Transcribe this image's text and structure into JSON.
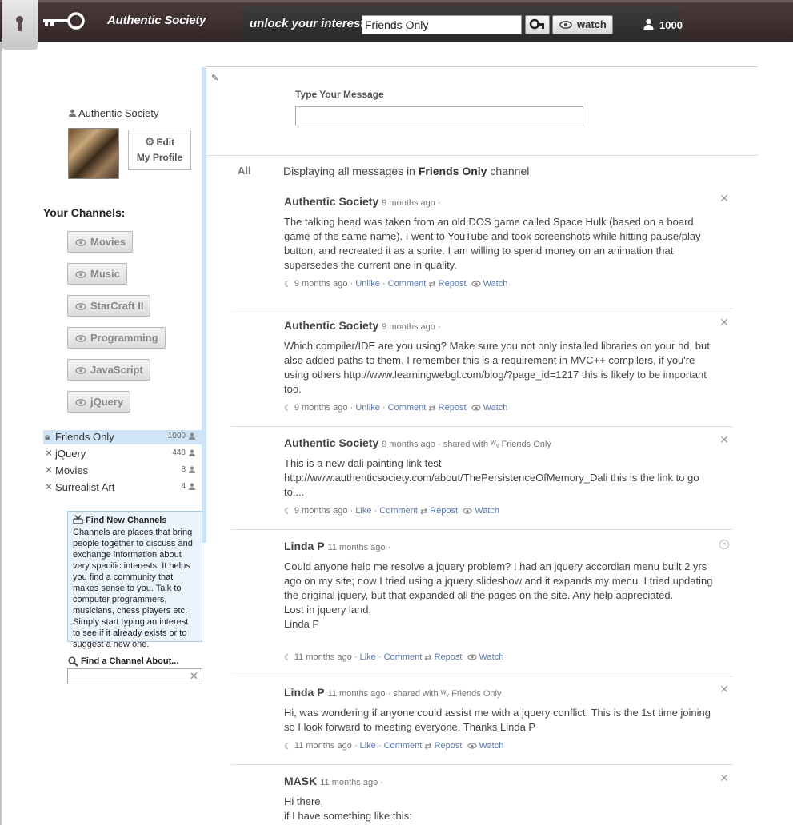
{
  "header": {
    "brand": "Authentic Society",
    "unlock_label": "unlock your interests",
    "search_value": "Friends Only",
    "watch_label": "watch",
    "member_count": "1000"
  },
  "compose": {
    "label": "Type Your Message",
    "value": ""
  },
  "profile": {
    "name": "Authentic Society",
    "edit_label_1": "Edit",
    "edit_label_2": "My Profile"
  },
  "channels": {
    "heading": "Your Channels:",
    "buttons": [
      "Movies",
      "Music",
      "StarCraft II",
      "Programming",
      "JavaScript",
      "jQuery"
    ]
  },
  "subscriptions": [
    {
      "name": "Friends Only",
      "count": "1000",
      "active": true
    },
    {
      "name": "jQuery",
      "count": "448",
      "active": false
    },
    {
      "name": "Movies",
      "count": "8",
      "active": false
    },
    {
      "name": "Surrealist Art",
      "count": "4",
      "active": false
    }
  ],
  "find_channels": {
    "title": "Find New Channels",
    "text": "Channels are places that bring people together to discuss and exchange information about very specific interests. It helps you find a community that makes sense to you. Talk to computer programmers, musicians, chess players etc. Simply start typing an interest to see if it already exists or to suggest a new one.",
    "about_label": "Find a Channel About..."
  },
  "feed": {
    "filter_all": "All",
    "header_prefix": "Displaying all messages in",
    "header_channel": "Friends Only",
    "header_suffix": "channel",
    "messages": [
      {
        "author": "Authentic Society",
        "time": "9 months ago",
        "meta_suffix": "·",
        "body": "The talking head was taken from an old DOS game called Space Hulk (based on a board game of the same name). I went to YouTube and took screenshots while hitting pause/play button, and recreated it as a sprite. I am willing to spend money on an animation that supersedes the current one in quality.",
        "action_time": "9 months ago",
        "like": "Unlike",
        "comment": "Comment",
        "repost": "Repost",
        "watch": "Watch"
      },
      {
        "author": "Authentic Society",
        "time": "9 months ago",
        "meta_suffix": "·",
        "body": "Which compiler/IDE are you using? Make sure you not only installed libraries on your hd, but also added paths to them. I remember this is a requirement in MVC++ compilers, if you're using others http://www.learningwebgl.com/blog/?page_id=1217 this is likely to be important too.",
        "action_time": "9 months ago",
        "like": "Unlike",
        "comment": "Comment",
        "repost": "Repost",
        "watch": "Watch"
      },
      {
        "author": "Authentic Society",
        "time": "9 months ago",
        "meta_suffix": "· shared with",
        "shared": "Friends Only",
        "body": "This is a new dali painting link test http://www.authenticsociety.com/about/ThePersistenceOfMemory_Dali this is the link to go to....",
        "action_time": "9 months ago",
        "like": "Like",
        "comment": "Comment",
        "repost": "Repost",
        "watch": "Watch"
      },
      {
        "author": "Linda P",
        "time": "11 months ago",
        "meta_suffix": "·",
        "body": "Could anyone help me resolve a jquery problem? I had an jquery accordian menu built 2 yrs ago on my site; now I tried using a jquery slideshow and it expands my menu. I tried updating the original jquery, but that expanded all the pages on the site. Any help appreciated.\nLost in jquery land,\nLinda P",
        "action_time": "11 months ago",
        "like": "Like",
        "comment": "Comment",
        "repost": "Repost",
        "watch": "Watch"
      },
      {
        "author": "Linda P",
        "time": "11 months ago",
        "meta_suffix": "· shared with",
        "shared": "Friends Only",
        "body": "Hi, was wondering if anyone could assist me with a jquery conflict. This is the 1st time joining so I look forward to meeting everyone. Thanks Linda P",
        "action_time": "11 months ago",
        "like": "Like",
        "comment": "Comment",
        "repost": "Repost",
        "watch": "Watch"
      },
      {
        "author": "MASK",
        "time": "11 months ago",
        "meta_suffix": "·",
        "body": "Hi there,\nif I have something like this:"
      }
    ]
  },
  "colors": {
    "topbar": "#3f3032",
    "link": "#5a7ab8",
    "active_channel": "#cfe4f7",
    "info_box": "#ebf4fd"
  }
}
